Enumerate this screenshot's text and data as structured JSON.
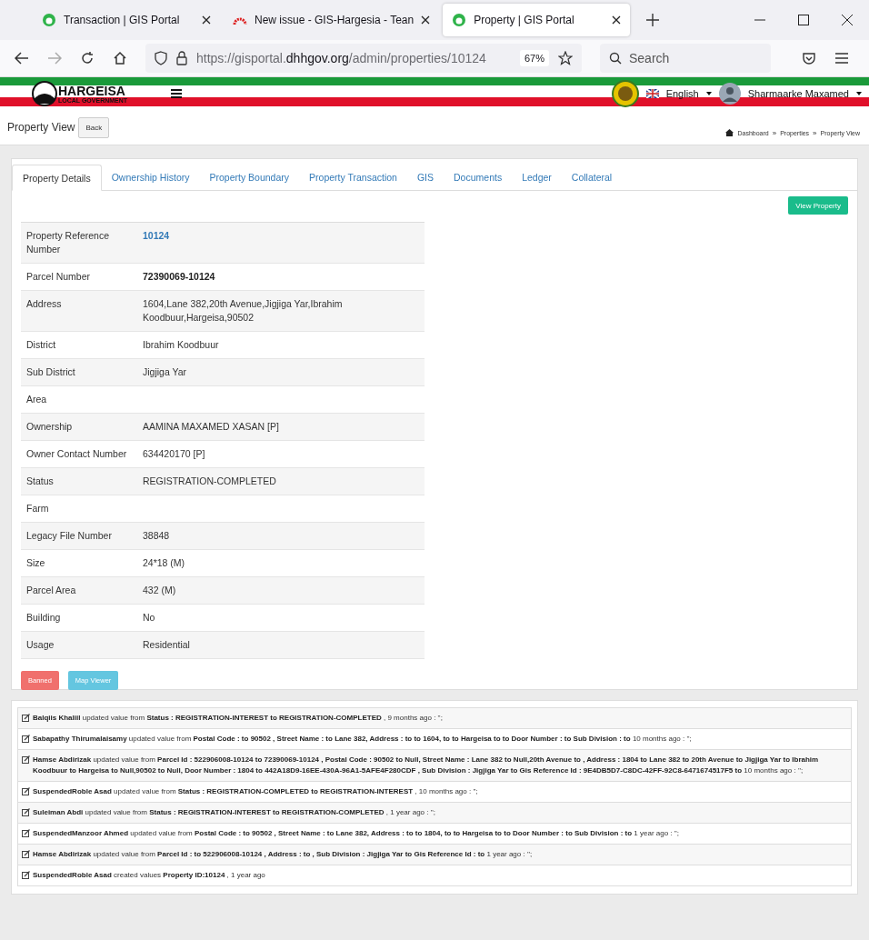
{
  "browser": {
    "tabs": [
      {
        "title": "Transaction | GIS Portal",
        "selected": false
      },
      {
        "title": "New issue - GIS-Hargesia - Tean",
        "selected": false
      },
      {
        "title": "Property | GIS Portal",
        "selected": true
      }
    ],
    "url": {
      "prefix": "https://gisportal.",
      "domain": "dhhgov.org",
      "path": "/admin/properties/10124"
    },
    "zoom": "67%",
    "search_placeholder": "Search"
  },
  "header": {
    "brand": "HARGEISA",
    "brand_sub": "LOCAL GOVERNMENT",
    "language": "English",
    "user": "Sharmaarke Maxamed"
  },
  "page": {
    "title": "Property View",
    "back": "Back",
    "breadcrumbs": [
      "Dashboard",
      "Properties",
      "Property View"
    ],
    "breadcrumb_separator": "»"
  },
  "tabs": [
    {
      "label": "Property Details",
      "selected": true
    },
    {
      "label": "Ownership History",
      "selected": false
    },
    {
      "label": "Property Boundary",
      "selected": false
    },
    {
      "label": "Property Transaction",
      "selected": false
    },
    {
      "label": "GIS",
      "selected": false
    },
    {
      "label": "Documents",
      "selected": false
    },
    {
      "label": "Ledger",
      "selected": false
    },
    {
      "label": "Collateral",
      "selected": false
    }
  ],
  "view_button": "View Property",
  "details": [
    {
      "label": "Property Reference Number",
      "value": "10124",
      "kind": "link"
    },
    {
      "label": "Parcel Number",
      "value": "72390069-10124",
      "kind": "bold"
    },
    {
      "label": "Address",
      "value": "1604,Lane 382,20th Avenue,Jigjiga Yar,Ibrahim Koodbuur,Hargeisa,90502",
      "kind": "text"
    },
    {
      "label": "District",
      "value": "Ibrahim Koodbuur",
      "kind": "text"
    },
    {
      "label": "Sub District",
      "value": "Jigjiga Yar",
      "kind": "text"
    },
    {
      "label": "Area",
      "kind": "text"
    },
    {
      "label": "Ownership",
      "value": "AAMINA MAXAMED XASAN [P]",
      "kind": "text"
    },
    {
      "label": "Owner Contact Number",
      "value": "634420170 [P]",
      "kind": "text"
    },
    {
      "label": "Status",
      "value": "REGISTRATION-COMPLETED",
      "kind": "text"
    },
    {
      "label": "Farm",
      "kind": "text"
    },
    {
      "label": "Legacy File Number",
      "value": "38848",
      "kind": "text"
    },
    {
      "label": "Size",
      "value": "24*18 (M)",
      "kind": "text"
    },
    {
      "label": "Parcel Area",
      "value": "432 (M)",
      "kind": "text"
    },
    {
      "label": "Building",
      "value": "No",
      "kind": "text"
    },
    {
      "label": "Usage",
      "value": "Residential",
      "kind": "text"
    }
  ],
  "actions": [
    {
      "label": "Banned",
      "kind": "danger"
    },
    {
      "label": "Map Viewer",
      "kind": "info"
    }
  ],
  "activity_log": [
    "**Balqiis Khaliil** updated value from **Status : REGISTRATION-INTEREST to REGISTRATION-COMPLETED** , 9 months ago : '';",
    "**Sabapathy Thirumalaisamy** updated value from **Postal Code : to 90502 , Street Name : to Lane 382, Address : to to 1604, to to Hargeisa to to Door Number : to Sub Division : to** 10 months ago : '';",
    "**Hamse Abdirizak** updated value from **Parcel Id : 522906008-10124 to 72390069-10124 , Postal Code : 90502 to Null, Street Name : Lane 382 to Null,20th Avenue to , Address : 1804 to Lane 382 to 20th Avenue to Jigjiga Yar to Ibrahim Koodbuur to Hargeisa to Null,90502 to Null, Door Number : 1804 to 442A18D9-16EE-430A-96A1-5AFE4F280CDF , Sub Division : Jigjiga Yar to Gis Reference Id : 9E4DB5D7-C8DC-42FF-92C8-6471674517F5 to** 10 months ago : '';",
    "**SuspendedRoble Asad** updated value from **Status : REGISTRATION-COMPLETED to REGISTRATION-INTEREST** , 10 months ago : '';",
    "**Suleiman Abdi** updated value from **Status : REGISTRATION-INTEREST to REGISTRATION-COMPLETED** , 1 year ago : '';",
    "**SuspendedManzoor Ahmed** updated value from **Postal Code : to 90502 , Street Name : to Lane 382, Address : to to 1804, to to Hargeisa to to Door Number : to Sub Division : to** 1 year ago : '';",
    "**Hamse Abdirizak** updated value from **Parcel Id : to 522906008-10124 , Address : to , Sub Division : Jigjiga Yar to Gis Reference Id : to** 1 year ago : '';",
    "**SuspendedRoble Asad** created values **Property ID:10124** , 1 year ago"
  ]
}
